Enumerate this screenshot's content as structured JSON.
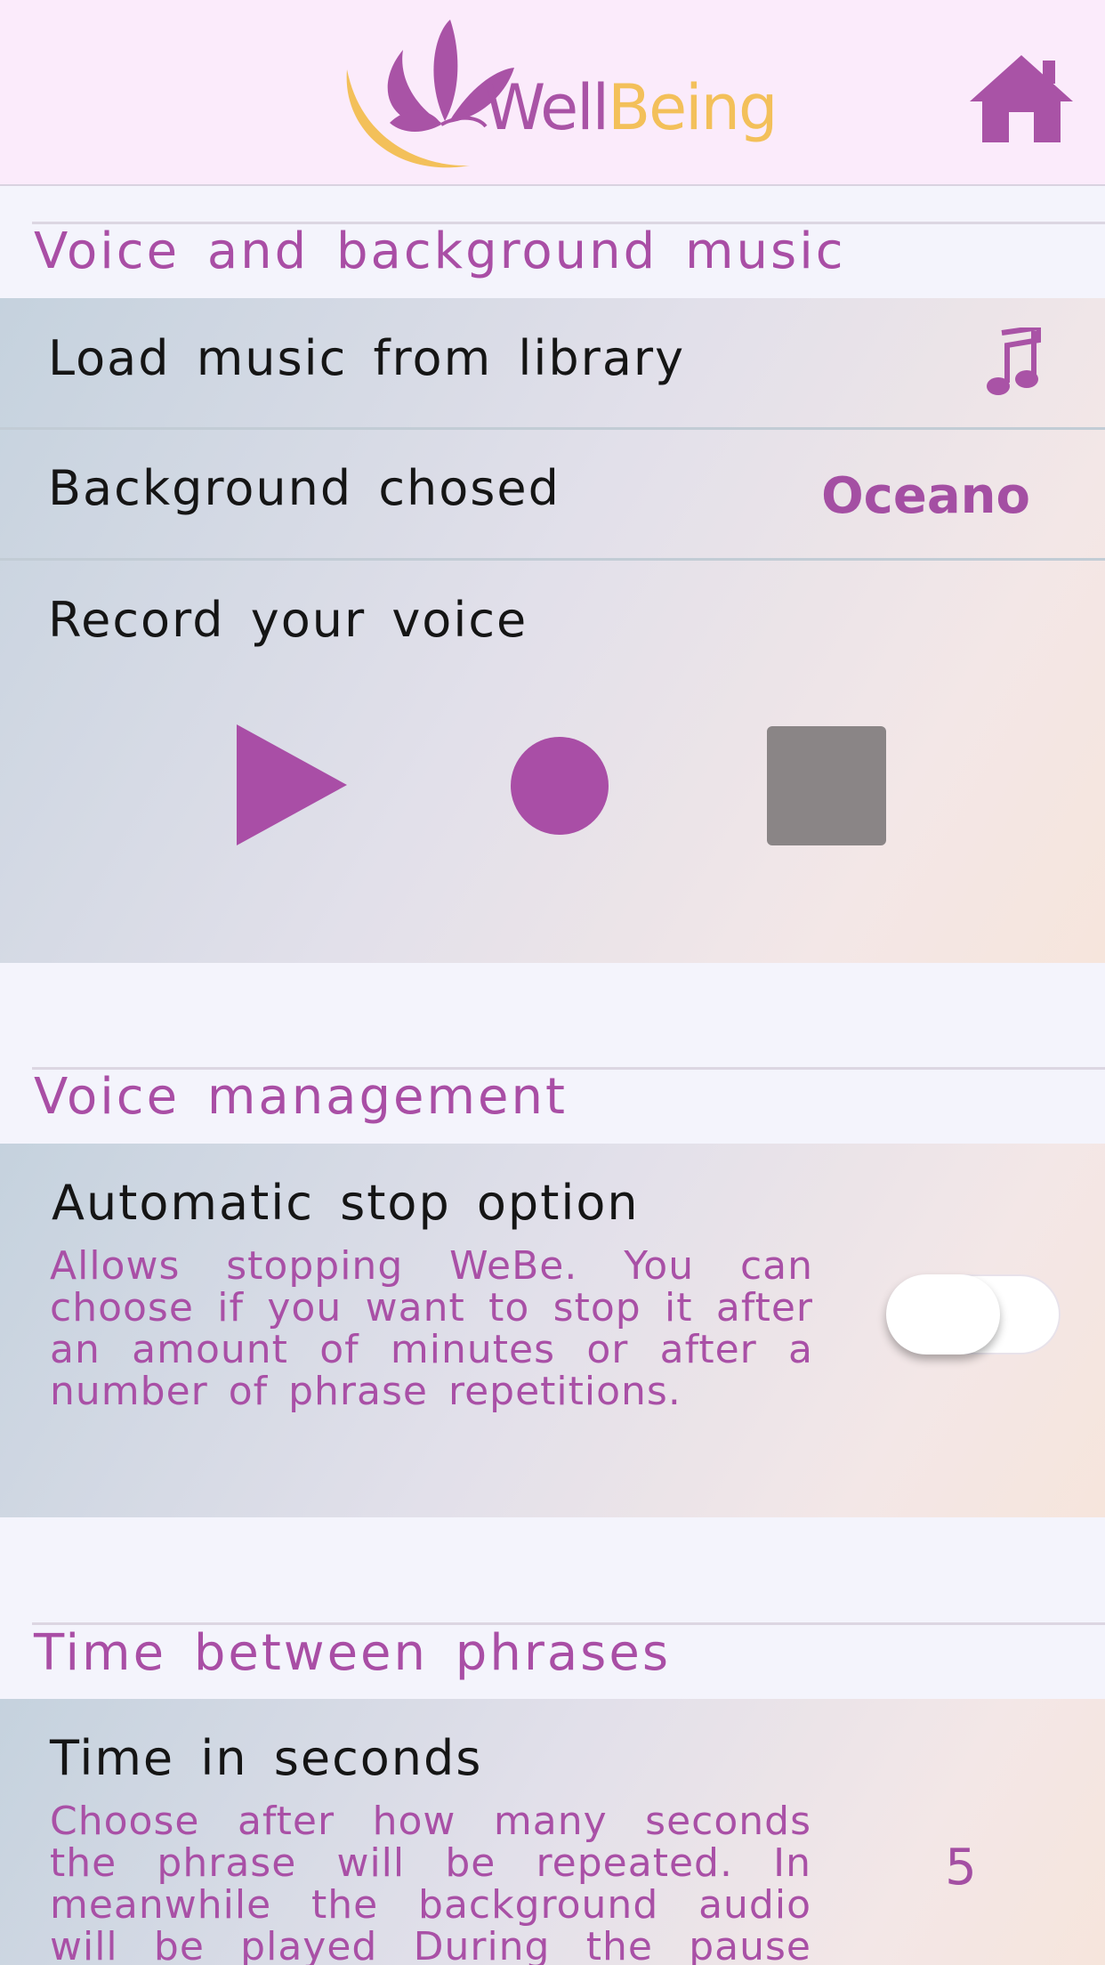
{
  "header": {
    "logo_well": "Well",
    "logo_being": "Being",
    "home_icon": "home-icon"
  },
  "colors": {
    "accent": "#a94ea5",
    "logo_yellow": "#f3c05a",
    "stop_gray": "#8a8586"
  },
  "voice_music": {
    "title": "Voice and background music",
    "load_music_label": "Load music from library",
    "load_music_icon": "music-note-icon",
    "background_label": "Background chosed",
    "background_value": "Oceano",
    "record_label": "Record your voice",
    "controls": [
      "play-icon",
      "record-icon",
      "stop-icon"
    ]
  },
  "voice_management": {
    "title": "Voice management",
    "option_label": "Automatic stop option",
    "option_desc": "Allows stopping WeBe. You can choose if you want to stop it after an amount of minutes or after a number of phrase repetitions.",
    "toggle_on": false
  },
  "time_between": {
    "title": "Time between phrases",
    "label": "Time in seconds",
    "desc": "Choose after how many seconds the phrase will be repeated. In meanwhile the background audio will be played During the pause time",
    "value": "5"
  }
}
